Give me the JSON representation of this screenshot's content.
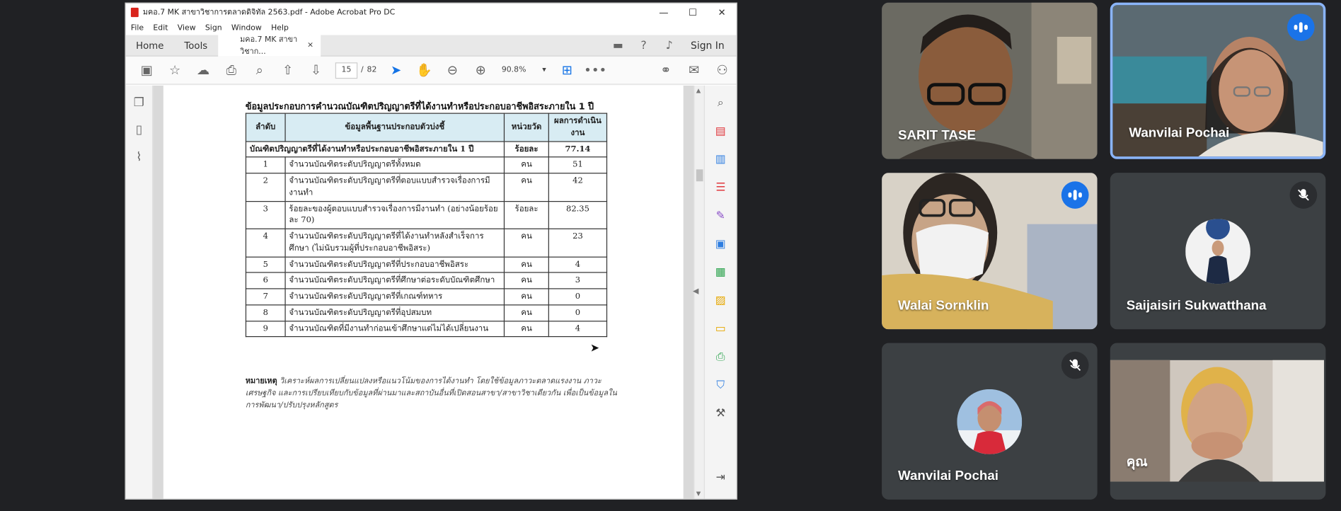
{
  "acrobat": {
    "window_title": "มคอ.7 MK สาขาวิชาการตลาดดิจิทัล 2563.pdf - Adobe Acrobat Pro DC",
    "win_controls": {
      "minimize": "—",
      "maximize": "☐",
      "close": "✕"
    },
    "menu": [
      "File",
      "Edit",
      "View",
      "Sign",
      "Window",
      "Help"
    ],
    "tabs": {
      "home": "Home",
      "tools": "Tools",
      "doc": "มคอ.7 MK สาขาวิชาก...",
      "close": "×"
    },
    "sign_in": "Sign In",
    "page": {
      "current": "15",
      "separator": "/",
      "total": "82"
    },
    "zoom": {
      "value": "90.8%",
      "arrow": "▾"
    }
  },
  "document": {
    "heading": "ข้อมูลประกอบการคำนวณบัณฑิตปริญญาตรีที่ได้งานทำหรือประกอบอาชีพอิสระภายใน 1 ปี",
    "columns": [
      "ลำดับ",
      "ข้อมูลพื้นฐานประกอบตัวบ่งชี้",
      "หน่วยวัด",
      "ผลการดำเนินงาน"
    ],
    "summary": {
      "label": "บัณฑิตปริญญาตรีที่ได้งานทำหรือประกอบอาชีพอิสระภายใน 1 ปี",
      "unit": "ร้อยละ",
      "value": "77.14"
    },
    "rows": [
      {
        "no": "1",
        "desc": "จำนวนบัณฑิตระดับปริญญาตรีทั้งหมด",
        "unit": "คน",
        "value": "51"
      },
      {
        "no": "2",
        "desc": "จำนวนบัณฑิตระดับปริญญาตรีที่ตอบแบบสำรวจเรื่องการมีงานทำ",
        "unit": "คน",
        "value": "42"
      },
      {
        "no": "3",
        "desc": "ร้อยละของผู้ตอบแบบสำรวจเรื่องการมีงานทำ (อย่างน้อยร้อยละ 70)",
        "unit": "ร้อยละ",
        "value": "82.35"
      },
      {
        "no": "4",
        "desc": "จำนวนบัณฑิตระดับปริญญาตรีที่ได้งานทำหลังสำเร็จการศึกษา (ไม่นับรวมผู้ที่ประกอบอาชีพอิสระ)",
        "unit": "คน",
        "value": "23"
      },
      {
        "no": "5",
        "desc": "จำนวนบัณฑิตระดับปริญญาตรีที่ประกอบอาชีพอิสระ",
        "unit": "คน",
        "value": "4"
      },
      {
        "no": "6",
        "desc": "จำนวนบัณฑิตระดับปริญญาตรีที่ศึกษาต่อระดับบัณฑิตศึกษา",
        "unit": "คน",
        "value": "3"
      },
      {
        "no": "7",
        "desc": "จำนวนบัณฑิตระดับปริญญาตรีที่เกณฑ์ทหาร",
        "unit": "คน",
        "value": "0"
      },
      {
        "no": "8",
        "desc": "จำนวนบัณฑิตระดับปริญญาตรีที่อุปสมบท",
        "unit": "คน",
        "value": "0"
      },
      {
        "no": "9",
        "desc": "จำนวนบัณฑิตที่มีงานทำก่อนเข้าศึกษาแต่ไม่ได้เปลี่ยนงาน",
        "unit": "คน",
        "value": "4"
      }
    ],
    "note_label": "หมายเหตุ",
    "note_text": "วิเคราะห์ผลการเปลี่ยนแปลงหรือแนวโน้มของการได้งานทำ โดยใช้ข้อมูลภาวะตลาดแรงงาน ภาวะเศรษฐกิจ และการเปรียบเทียบกับข้อมูลที่ผ่านมาและสถาบันอื่นที่เปิดสอนสาขา/สาขาวิชาเดียวกัน เพื่อเป็นข้อมูลในการพัฒนา/ปรับปรุงหลักสูตร"
  },
  "participants": [
    {
      "name": "SARIT TASE",
      "status": "none"
    },
    {
      "name": "Wanvilai Pochai",
      "status": "speaking"
    },
    {
      "name": "Walai Sornklin",
      "status": "speaking"
    },
    {
      "name": "Saijaisiri Sukwatthana",
      "status": "muted"
    },
    {
      "name": "Wanvilai Pochai",
      "status": "muted"
    },
    {
      "name": "คุณ",
      "status": "none"
    }
  ],
  "colors": {
    "meet_bg": "#202124",
    "tile_bg": "#3c4043",
    "speaking_blue": "#1a73e8",
    "active_border": "#8ab4f8",
    "acrobat_blue": "#1473e6",
    "table_header": "#d8ecf3"
  }
}
